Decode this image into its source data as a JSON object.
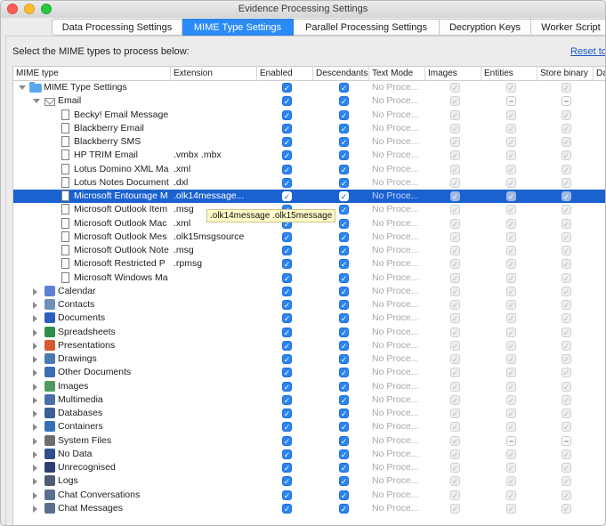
{
  "window": {
    "title": "Evidence Processing Settings"
  },
  "tabs": [
    {
      "label": "Data Processing Settings",
      "active": false
    },
    {
      "label": "MIME Type Settings",
      "active": true
    },
    {
      "label": "Parallel Processing Settings",
      "active": false
    },
    {
      "label": "Decryption Keys",
      "active": false
    },
    {
      "label": "Worker Script",
      "active": false
    }
  ],
  "instruction": "Select the MIME types to process below:",
  "reset_link": "Reset to",
  "columns": [
    "MIME type",
    "Extension",
    "Enabled",
    "Descendants",
    "Text Mode",
    "Images",
    "Entities",
    "Store binary",
    "Da"
  ],
  "text_mode_value": "No Proce...",
  "tooltip": ".olk14message .olk15message",
  "colors": {
    "accent": "#2a84f2",
    "selection": "#1b62d1",
    "tooltip_bg": "#fffcc8"
  },
  "rows": [
    {
      "label": "MIME Type Settings",
      "ext": "",
      "level": 0,
      "expander": "down",
      "icon": "folder-icon",
      "images": "dis",
      "entities": "dis",
      "store": "dis"
    },
    {
      "label": "Email",
      "ext": "",
      "level": 1,
      "expander": "down",
      "icon": "mail-icon",
      "images": "dis",
      "entities": "mix",
      "store": "mix"
    },
    {
      "label": "Becky! Email Message",
      "ext": "",
      "level": 2,
      "icon": "document-icon",
      "images": "dis",
      "entities": "dis",
      "store": "dis"
    },
    {
      "label": "Blackberry Email",
      "ext": "",
      "level": 2,
      "icon": "document-icon",
      "images": "dis",
      "entities": "dis",
      "store": "dis"
    },
    {
      "label": "Blackberry SMS",
      "ext": "",
      "level": 2,
      "icon": "document-icon",
      "images": "dis",
      "entities": "dis",
      "store": "dis"
    },
    {
      "label": "HP TRIM Email",
      "ext": ".vmbx .mbx",
      "level": 2,
      "icon": "document-icon",
      "images": "dis",
      "entities": "dis",
      "store": "dis"
    },
    {
      "label": "Lotus Domino XML Ma",
      "ext": ".xml",
      "level": 2,
      "icon": "document-icon",
      "images": "dis",
      "entities": "dis",
      "store": "dis"
    },
    {
      "label": "Lotus Notes Document",
      "ext": ".dxl",
      "level": 2,
      "icon": "document-icon",
      "images": "dis",
      "entities": "dis",
      "store": "dis"
    },
    {
      "label": "Microsoft Entourage M",
      "ext": ".olk14message...",
      "level": 2,
      "icon": "document-icon",
      "selected": true,
      "images": "dis",
      "entities": "dis",
      "store": "dis"
    },
    {
      "label": "Microsoft Outlook Item",
      "ext": ".msg",
      "level": 2,
      "icon": "document-icon",
      "images": "dis",
      "entities": "dis",
      "store": "dis"
    },
    {
      "label": "Microsoft Outlook Mac",
      "ext": ".xml",
      "level": 2,
      "icon": "document-icon",
      "images": "dis",
      "entities": "dis",
      "store": "dis"
    },
    {
      "label": "Microsoft Outlook Mes",
      "ext": ".olk15msgsource",
      "level": 2,
      "icon": "document-icon",
      "images": "dis",
      "entities": "dis",
      "store": "dis"
    },
    {
      "label": "Microsoft Outlook Note",
      "ext": ".msg",
      "level": 2,
      "icon": "document-icon",
      "images": "dis",
      "entities": "dis",
      "store": "dis"
    },
    {
      "label": "Microsoft Restricted P",
      "ext": ".rpmsg",
      "level": 2,
      "icon": "document-icon",
      "images": "dis",
      "entities": "dis",
      "store": "dis"
    },
    {
      "label": "Microsoft Windows Ma",
      "ext": "",
      "level": 2,
      "icon": "document-icon",
      "images": "dis",
      "entities": "dis",
      "store": "dis"
    },
    {
      "label": "Calendar",
      "ext": "",
      "level": 1,
      "expander": "right",
      "icon": "calendar-icon",
      "color": "#5d7fd8",
      "images": "dis",
      "entities": "dis",
      "store": "dis"
    },
    {
      "label": "Contacts",
      "ext": "",
      "level": 1,
      "expander": "right",
      "icon": "contacts-icon",
      "color": "#6f8fb8",
      "images": "dis",
      "entities": "dis",
      "store": "dis"
    },
    {
      "label": "Documents",
      "ext": "",
      "level": 1,
      "expander": "right",
      "icon": "documents-icon",
      "color": "#2d5fbf",
      "images": "dis",
      "entities": "dis",
      "store": "dis"
    },
    {
      "label": "Spreadsheets",
      "ext": "",
      "level": 1,
      "expander": "right",
      "icon": "spreadsheets-icon",
      "color": "#2f8f4a",
      "images": "dis",
      "entities": "dis",
      "store": "dis"
    },
    {
      "label": "Presentations",
      "ext": "",
      "level": 1,
      "expander": "right",
      "icon": "presentations-icon",
      "color": "#d7592f",
      "images": "dis",
      "entities": "dis",
      "store": "dis"
    },
    {
      "label": "Drawings",
      "ext": "",
      "level": 1,
      "expander": "right",
      "icon": "drawings-icon",
      "color": "#4a7ab0",
      "images": "dis",
      "entities": "dis",
      "store": "dis"
    },
    {
      "label": "Other Documents",
      "ext": "",
      "level": 1,
      "expander": "right",
      "icon": "other-documents-icon",
      "color": "#3b6fb5",
      "images": "dis",
      "entities": "dis",
      "store": "dis"
    },
    {
      "label": "Images",
      "ext": "",
      "level": 1,
      "expander": "right",
      "icon": "images-icon",
      "color": "#4f9a5f",
      "images": "dis",
      "entities": "dis",
      "store": "dis"
    },
    {
      "label": "Multimedia",
      "ext": "",
      "level": 1,
      "expander": "right",
      "icon": "multimedia-icon",
      "color": "#4c6ea8",
      "images": "dis",
      "entities": "dis",
      "store": "dis"
    },
    {
      "label": "Databases",
      "ext": "",
      "level": 1,
      "expander": "right",
      "icon": "databases-icon",
      "color": "#3c5f95",
      "images": "dis",
      "entities": "dis",
      "store": "dis"
    },
    {
      "label": "Containers",
      "ext": "",
      "level": 1,
      "expander": "right",
      "icon": "containers-icon",
      "color": "#356fb8",
      "images": "dis",
      "entities": "dis",
      "store": "dis"
    },
    {
      "label": "System Files",
      "ext": "",
      "level": 1,
      "expander": "right",
      "icon": "system-files-icon",
      "color": "#6d6d6d",
      "images": "dis",
      "entities": "mix",
      "store": "mix"
    },
    {
      "label": "No Data",
      "ext": "",
      "level": 1,
      "expander": "right",
      "icon": "no-data-icon",
      "color": "#2f4f8f",
      "images": "dis",
      "entities": "dis",
      "store": "dis"
    },
    {
      "label": "Unrecognised",
      "ext": "",
      "level": 1,
      "expander": "right",
      "icon": "unrecognised-icon",
      "color": "#2c3f70",
      "images": "dis",
      "entities": "dis",
      "store": "dis"
    },
    {
      "label": "Logs",
      "ext": "",
      "level": 1,
      "expander": "right",
      "icon": "logs-icon",
      "color": "#4d5d75",
      "images": "dis",
      "entities": "dis",
      "store": "dis"
    },
    {
      "label": "Chat Conversations",
      "ext": "",
      "level": 1,
      "expander": "right",
      "icon": "chat-conversations-icon",
      "color": "#5a6f8f",
      "images": "dis",
      "entities": "dis",
      "store": "dis"
    },
    {
      "label": "Chat Messages",
      "ext": "",
      "level": 1,
      "expander": "right",
      "icon": "chat-messages-icon",
      "color": "#5a6f8f",
      "images": "dis",
      "entities": "dis",
      "store": "dis"
    }
  ]
}
